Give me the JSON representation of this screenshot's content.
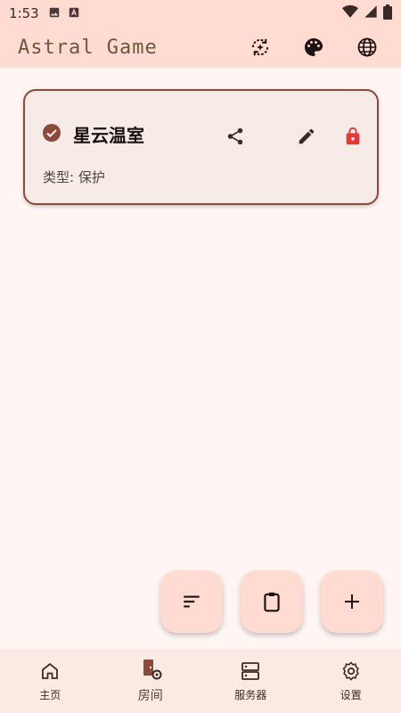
{
  "status_bar": {
    "time": "1:53",
    "left_icons": [
      "image-icon",
      "a-notification-icon"
    ],
    "right_icons": [
      "wifi-icon",
      "signal-icon",
      "battery-icon"
    ]
  },
  "app_bar": {
    "title": "Astral Game",
    "actions": [
      "sync-icon",
      "palette-icon",
      "globe-icon"
    ]
  },
  "rooms": [
    {
      "name": "星云温室",
      "type_label": "类型: 保护",
      "selected": true,
      "locked": true
    }
  ],
  "fabs": [
    "sort-icon",
    "clipboard-icon",
    "add-icon"
  ],
  "bottom_nav": {
    "items": [
      {
        "label": "主页",
        "icon": "home-icon"
      },
      {
        "label": "房间",
        "icon": "room-settings-icon"
      },
      {
        "label": "服务器",
        "icon": "server-icon"
      },
      {
        "label": "设置",
        "icon": "settings-icon"
      }
    ],
    "active_index": 1
  },
  "colors": {
    "bar_bg": "#ffdbd1",
    "page_bg": "#fff5f2",
    "card_border": "#8b4a3c",
    "lock_red": "#e53935",
    "title_color": "#6b5a3a"
  }
}
